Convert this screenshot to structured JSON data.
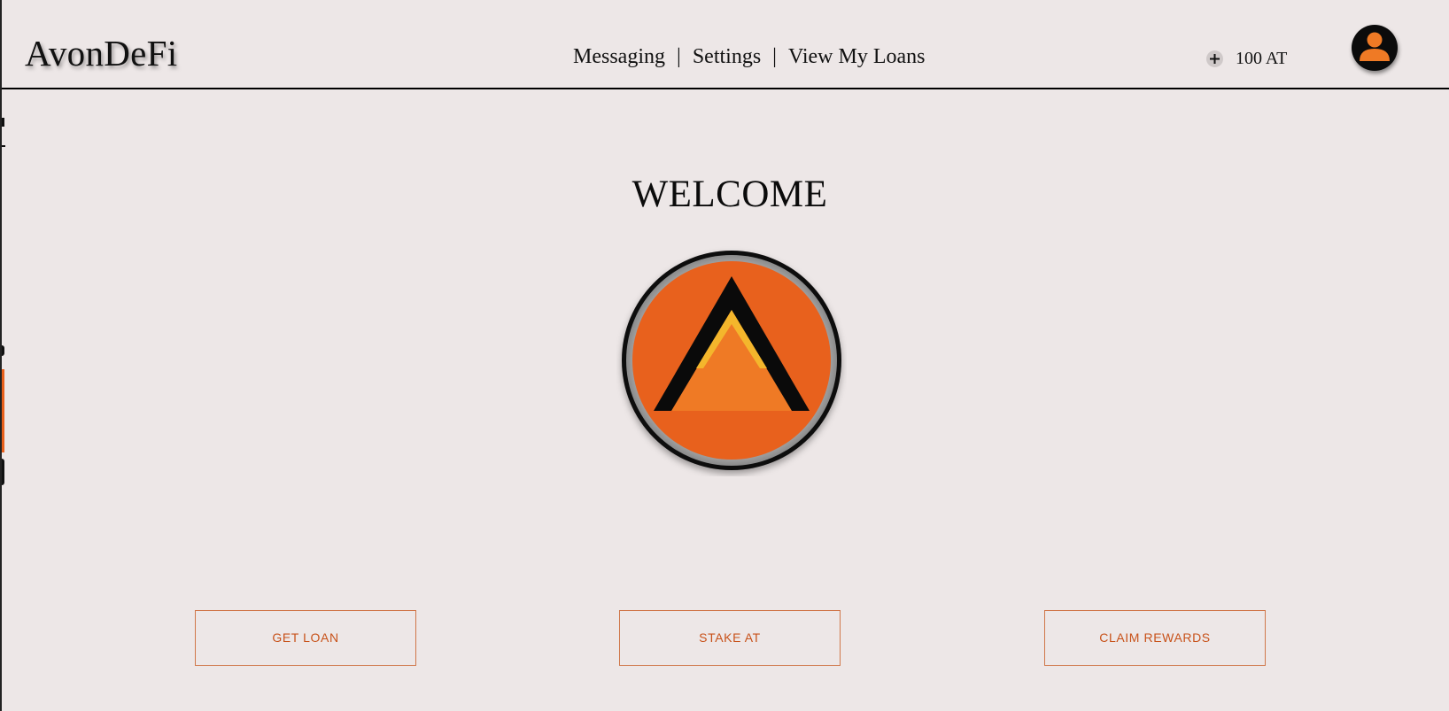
{
  "header": {
    "brand": "AvonDeFi",
    "nav": {
      "items": [
        {
          "label": "Messaging"
        },
        {
          "label": "Settings"
        },
        {
          "label": "View My Loans"
        }
      ],
      "separator": "|"
    },
    "balance": {
      "add_icon": "plus-icon",
      "text": "100 AT"
    },
    "avatar_icon": "user-icon"
  },
  "main": {
    "welcome": "WELCOME",
    "logo_icon": "avon-logo",
    "actions": [
      {
        "label": "GET LOAN"
      },
      {
        "label": "STAKE AT"
      },
      {
        "label": "CLAIM REWARDS"
      }
    ]
  },
  "colors": {
    "background": "#ede7e7",
    "accent": "#e8601c",
    "logo_orange": "#e8611d",
    "logo_inner": "#ef7a25",
    "logo_yellow": "#f4b62c",
    "button_text": "#c8521a"
  }
}
